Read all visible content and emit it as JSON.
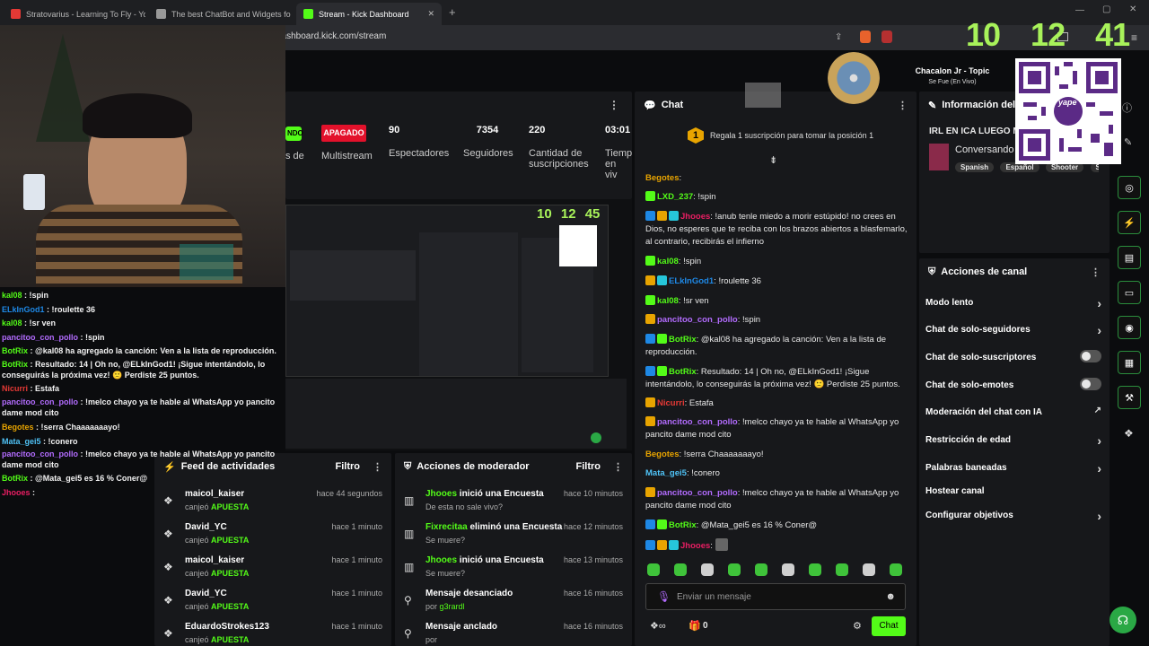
{
  "browser": {
    "tabs": [
      {
        "label": "Stratovarius - Learning To Fly - YouTu",
        "color": "#e53935"
      },
      {
        "label": "The best ChatBot and Widgets for Kick",
        "color": "#999999"
      },
      {
        "label": "Stream - Kick Dashboard",
        "color": "#53fc18"
      }
    ],
    "url": "dashboard.kick.com/stream"
  },
  "overlay": {
    "clock": [
      "10",
      "12",
      "41"
    ]
  },
  "stats": {
    "live_status": "NDO",
    "multistream_badge": "APAGADO",
    "multistream_label": "Multistream",
    "live_label_partial": "s de",
    "viewers": "90",
    "viewers_label": "Espectadores",
    "followers": "7354",
    "followers_label": "Seguidores",
    "subs": "220",
    "subs_label": "Cantidad de suscripciones",
    "time": "03:01",
    "time_label": "Tiemp en viv"
  },
  "preview_clock": [
    "10",
    "12",
    "45"
  ],
  "activity": {
    "title": "Feed de actividades",
    "filter": "Filtro",
    "rows": [
      {
        "user": "maicol_kaiser",
        "action": "canjeó",
        "what": "APUESTA",
        "time": "hace 44 segundos"
      },
      {
        "user": "David_YC",
        "action": "canjeó",
        "what": "APUESTA",
        "time": "hace 1 minuto"
      },
      {
        "user": "maicol_kaiser",
        "action": "canjeó",
        "what": "APUESTA",
        "time": "hace 1 minuto"
      },
      {
        "user": "David_YC",
        "action": "canjeó",
        "what": "APUESTA",
        "time": "hace 1 minuto"
      },
      {
        "user": "EduardoStrokes123",
        "action": "canjeó",
        "what": "APUESTA",
        "time": "hace 1 minuto"
      }
    ]
  },
  "modactions": {
    "title": "Acciones de moderador",
    "filter": "Filtro",
    "rows": [
      {
        "user": "Jhooes",
        "action": " inició una Encuesta",
        "sub": "De esta no sale vivo?",
        "time": "hace 10 minutos",
        "color": "#53fc18"
      },
      {
        "user": "Fixrecitaa",
        "action": " eliminó una Encuesta",
        "sub": "Se muere?",
        "time": "hace 12 minutos",
        "color": "#53fc18"
      },
      {
        "user": "Jhooes",
        "action": " inició una Encuesta",
        "sub": "Se muere?",
        "time": "hace 13 minutos",
        "color": "#53fc18"
      },
      {
        "user": "",
        "action": "Mensaje desanciado",
        "sub_prefix": "por ",
        "sub": "g3rardl",
        "time": "hace 16 minutos",
        "color": "#53fc18"
      },
      {
        "user": "",
        "action": "Mensaje anclado",
        "sub_prefix": "por ",
        "sub": "",
        "time": "hace 16 minutos",
        "color": "#53fc18"
      }
    ]
  },
  "chat": {
    "title": "Chat",
    "pinned": "Regala 1 suscripción para tomar la posición 1",
    "pinned_rank": "1",
    "messages": [
      {
        "user": "Begotes",
        "color": "#e8a400",
        "text": ""
      },
      {
        "user": "LXD_237",
        "color": "#53fc18",
        "text": "!spin"
      },
      {
        "user": "Jhooes",
        "color": "#e91e63",
        "text": "!anub tenle miedo a morir estúpido! no crees en Dios, no esperes que te reciba con los brazos abiertos a blasfemarlo, al contrario, recibirás el infierno"
      },
      {
        "user": "kal08",
        "color": "#53fc18",
        "text": "!spin"
      },
      {
        "user": "ELkInGod1",
        "color": "#1e88e5",
        "text": "!roulette 36"
      },
      {
        "user": "kal08",
        "color": "#53fc18",
        "text": "!sr ven"
      },
      {
        "user": "pancitoo_con_pollo",
        "color": "#b36cff",
        "text": "!spin"
      },
      {
        "user": "BotRix",
        "color": "#53fc18",
        "text": "@kal08 ha agregado la canción: Ven a la lista de reproducción."
      },
      {
        "user": "BotRix",
        "color": "#53fc18",
        "text": "Resultado: 14 | Oh no, @ELkInGod1! ¡Sigue intentándolo, lo conseguirás la próxima vez! 🙁 Perdiste 25 puntos."
      },
      {
        "user": "Nicurri",
        "color": "#e53935",
        "text": "Estafa"
      },
      {
        "user": "pancitoo_con_pollo",
        "color": "#b36cff",
        "text": "!melco chayo ya te hable al WhatsApp yo pancito dame mod cito"
      },
      {
        "user": "Begotes",
        "color": "#e8a400",
        "text": "!serra Chaaaaaaayo!"
      },
      {
        "user": "Mata_gei5",
        "color": "#4fc3f7",
        "text": "!conero"
      },
      {
        "user": "pancitoo_con_pollo",
        "color": "#b36cff",
        "text": "!melco chayo ya te hable al WhatsApp yo pancito dame mod cito"
      },
      {
        "user": "BotRix",
        "color": "#53fc18",
        "text": "@Mata_gei5 es 16 % Coner@"
      },
      {
        "user": "Jhooes",
        "color": "#e91e63",
        "text": ""
      }
    ],
    "input_placeholder": "Enviar un mensaje",
    "points": "0",
    "send": "Chat"
  },
  "info": {
    "title": "Información del str",
    "stream_title": "IRL EN ICA LUEGO MI",
    "category": "Conversando",
    "tags": [
      "Spanish",
      "Español",
      "Shooter",
      "Spa"
    ]
  },
  "channel": {
    "title": "Acciones de canal",
    "items": [
      {
        "label": "Modo lento",
        "type": "chev"
      },
      {
        "label": "Chat de solo-seguidores",
        "type": "chev"
      },
      {
        "label": "Chat de solo-suscriptores",
        "type": "toggle"
      },
      {
        "label": "Chat de solo-emotes",
        "type": "toggle"
      },
      {
        "label": "Moderación del chat con IA",
        "type": "ext"
      },
      {
        "label": "Restricción de edad",
        "type": "chev"
      },
      {
        "label": "Palabras baneadas",
        "type": "chev"
      },
      {
        "label": "Hostear canal",
        "type": "none"
      },
      {
        "label": "Configurar objetivos",
        "type": "chev"
      }
    ]
  },
  "nowplaying": {
    "title": "Chacalon Jr - Topic",
    "subtitle": "Se Fue (En Vivo)"
  },
  "qr": {
    "label": "yape"
  },
  "webcam_chat": [
    {
      "user": "kal08",
      "color": "#53fc18",
      "text": "!spin"
    },
    {
      "user": "ELkInGod1",
      "color": "#1e88e5",
      "text": "!roulette 36"
    },
    {
      "user": "kal08",
      "color": "#53fc18",
      "text": "!sr ven"
    },
    {
      "user": "pancitoo_con_pollo",
      "color": "#b36cff",
      "text": "!spin"
    },
    {
      "user": "BotRix",
      "color": "#53fc18",
      "text": "@kal08 ha agregado la canción: Ven a la lista de reproducción."
    },
    {
      "user": "BotRix",
      "color": "#53fc18",
      "text": "Resultado: 14 | Oh no, @ELkInGod1! ¡Sigue intentándolo, lo conseguirás la próxima vez! 🙁 Perdiste 25 puntos."
    },
    {
      "user": "Nicurri",
      "color": "#e53935",
      "text": "Estafa"
    },
    {
      "user": "pancitoo_con_pollo",
      "color": "#b36cff",
      "text": "!melco chayo ya te hable al WhatsApp yo pancito dame mod cito"
    },
    {
      "user": "Begotes",
      "color": "#e8a400",
      "text": "!serra Chaaaaaaayo!"
    },
    {
      "user": "Mata_gei5",
      "color": "#4fc3f7",
      "text": "!conero"
    },
    {
      "user": "pancitoo_con_pollo",
      "color": "#b36cff",
      "text": "!melco chayo ya te hable al WhatsApp yo pancito dame mod cito"
    },
    {
      "user": "BotRix",
      "color": "#53fc18",
      "text": "@Mata_gei5 es 16 % Coner@"
    },
    {
      "user": "Jhooes",
      "color": "#e91e63",
      "text": ""
    }
  ]
}
